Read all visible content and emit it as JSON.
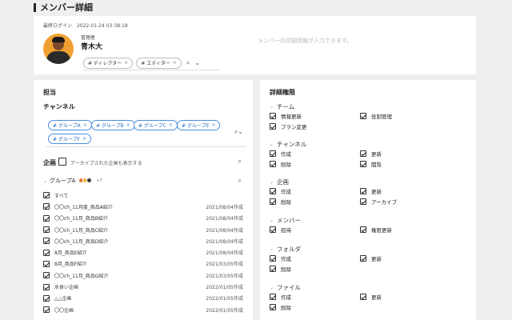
{
  "page_title": "メンバー詳細",
  "profile": {
    "last_login_label": "最終ログイン",
    "last_login": "2022-01-24 03:38:18",
    "role": "管理者",
    "name": "青木大",
    "tags": [
      {
        "label": "# ディレクター"
      },
      {
        "label": "# エディター"
      }
    ],
    "placeholder": "メンバーの詳細情報が入力できます。"
  },
  "tanto": {
    "title": "担当",
    "channel_label": "チャンネル",
    "channels": [
      "# グループA",
      "# グループB",
      "# グループC",
      "# グループE",
      "# グループF"
    ],
    "kikaku_label": "企画",
    "archive_label": "アーカイブされた企画も表示する",
    "group_name": "グループA",
    "group_more": "+7",
    "all_label": "すべて",
    "rows": [
      {
        "title": "〇〇ch_11月度_商品A紹介",
        "date": "2021/08/04作成"
      },
      {
        "title": "〇〇ch_11月_商品B紹介",
        "date": "2021/08/04作成"
      },
      {
        "title": "〇〇ch_11月_商品C紹介",
        "date": "2021/08/04作成"
      },
      {
        "title": "〇〇ch_11月_商品D紹介",
        "date": "2021/08/04作成"
      },
      {
        "title": "8月_商品E紹介",
        "date": "2021/08/04作成"
      },
      {
        "title": "8月_商品F紹介",
        "date": "2021/03/05作成"
      },
      {
        "title": "〇〇ch_11月_商品G紹介",
        "date": "2021/03/05作成"
      },
      {
        "title": "水食い企画",
        "date": "2022/01/05作成"
      },
      {
        "title": "△△企画",
        "date": "2022/01/05作成"
      },
      {
        "title": "〇〇企画",
        "date": "2022/01/05作成"
      }
    ]
  },
  "kengen": {
    "title": "詳細権限",
    "groups": [
      {
        "name": "チーム",
        "items": [
          "情報更新",
          "役割管理",
          "プラン変更"
        ]
      },
      {
        "name": "チャンネル",
        "items": [
          "作成",
          "更新",
          "削除",
          "閲覧"
        ]
      },
      {
        "name": "企画",
        "items": [
          "作成",
          "更新",
          "削除",
          "アーカイブ"
        ]
      },
      {
        "name": "メンバー",
        "items": [
          "招待",
          "権限更新"
        ]
      },
      {
        "name": "フォルダ",
        "items": [
          "作成",
          "更新",
          "削除"
        ]
      },
      {
        "name": "ファイル",
        "items": [
          "作成",
          "更新",
          "削除"
        ]
      }
    ]
  },
  "colors": {
    "accent": "#4a8fe0",
    "avatar_bg": "#f0a030"
  }
}
